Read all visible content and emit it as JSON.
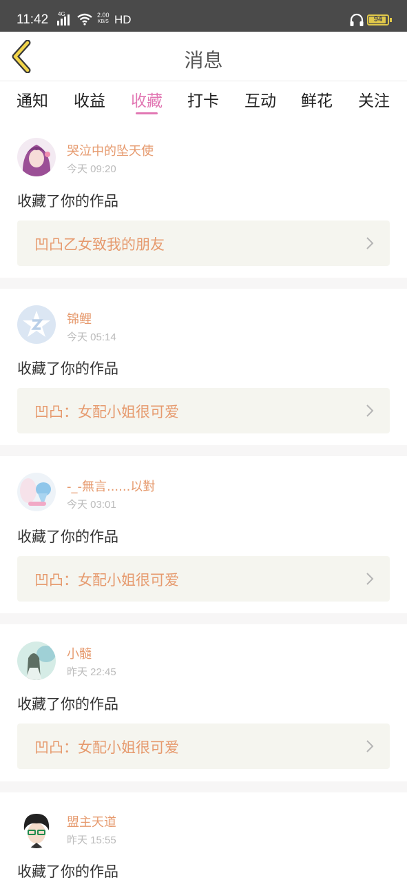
{
  "statusbar": {
    "time": "11:42",
    "network": "4G",
    "speed_value": "2.00",
    "speed_unit": "KB/S",
    "hd": "HD",
    "battery": "94",
    "battery_level": 0.94
  },
  "header": {
    "title": "消息"
  },
  "tabs": [
    {
      "label": "通知"
    },
    {
      "label": "收益"
    },
    {
      "label": "收藏",
      "active": true
    },
    {
      "label": "打卡"
    },
    {
      "label": "互动"
    },
    {
      "label": "鲜花"
    },
    {
      "label": "关注"
    }
  ],
  "feed": [
    {
      "username": "哭泣中的坠天使",
      "time": "今天 09:20",
      "action": "收藏了你的作品",
      "work": "凹凸乙女致我的朋友"
    },
    {
      "username": "锦鲤",
      "time": "今天 05:14",
      "action": "收藏了你的作品",
      "work": "凹凸：女配小姐很可爱"
    },
    {
      "username": "-_-無言......以對",
      "time": "今天 03:01",
      "action": "收藏了你的作品",
      "work": "凹凸：女配小姐很可爱"
    },
    {
      "username": "小髓",
      "time": "昨天 22:45",
      "action": "收藏了你的作品",
      "work": "凹凸：女配小姐很可爱"
    },
    {
      "username": "盟主天道",
      "time": "昨天 15:55",
      "action": "收藏了你的作品"
    }
  ],
  "colors": {
    "accent": "#e277b3",
    "username": "#e69a6e",
    "work_bg": "#f5f5ef",
    "statusbar_bg": "#4a4a4a"
  }
}
